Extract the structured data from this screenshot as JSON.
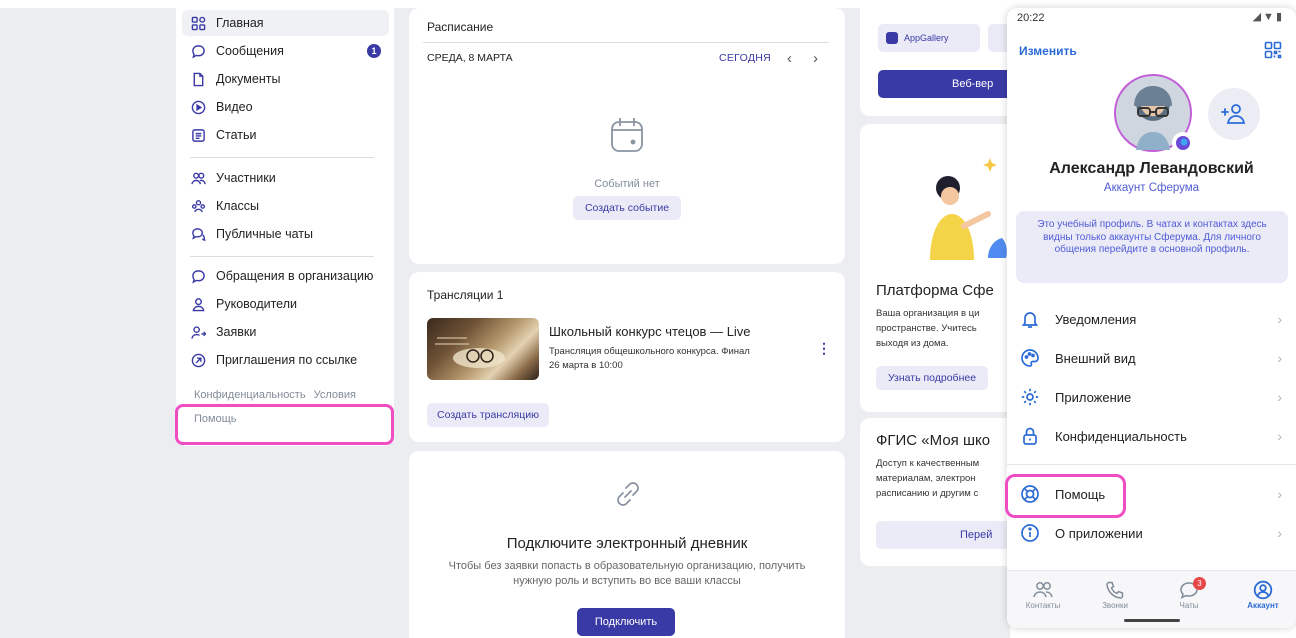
{
  "sidebar": {
    "items": [
      {
        "label": "Главная"
      },
      {
        "label": "Сообщения",
        "badge": "1"
      },
      {
        "label": "Документы"
      },
      {
        "label": "Видео"
      },
      {
        "label": "Статьи"
      },
      {
        "label": "Участники"
      },
      {
        "label": "Классы"
      },
      {
        "label": "Публичные чаты"
      },
      {
        "label": "Обращения в организацию"
      },
      {
        "label": "Руководители"
      },
      {
        "label": "Заявки"
      },
      {
        "label": "Приглашения по ссылке"
      }
    ],
    "footer": {
      "privacy": "Конфиденциальность",
      "terms": "Условия",
      "help": "Помощь"
    }
  },
  "schedule": {
    "title": "Расписание",
    "date": "СРЕДА, 8 МАРТА",
    "today": "СЕГОДНЯ",
    "prev": "‹",
    "next": "›",
    "empty": "Событий нет",
    "create_button": "Создать событие"
  },
  "streams": {
    "title": "Трансляции 1",
    "item": {
      "title": "Школьный конкурс чтецов — Live",
      "subtitle": "Трансляция общешкольного конкурса. Финал",
      "date": "26 марта в 10:00"
    },
    "menu": "⋮",
    "create_button": "Создать трансляцию"
  },
  "diary": {
    "title": "Подключите электронный дневник",
    "text_line1": "Чтобы без заявки попасть в образовательную организацию, получить",
    "text_line2": "нужную роль и вступить во все ваши классы",
    "button": "Подключить"
  },
  "right_column": {
    "appgallery": "AppGallery",
    "web_button": "Веб-вер",
    "platform_title": "Платформа Сфе",
    "platform_text_1": "Ваша организация в ци",
    "platform_text_2": "пространстве. Учитесь",
    "platform_text_3": "выходя из дома.",
    "learn_more": "Узнать подробнее",
    "fgis_title": "ФГИС «Моя шко",
    "fgis_text_1": "Доступ к качественным",
    "fgis_text_2": "материалам, электрон",
    "fgis_text_3": "расписанию и другим с",
    "go_button": "Перей"
  },
  "phone": {
    "time": "20:22",
    "status_icons": "◢▼▮",
    "edit": "Изменить",
    "name": "Александр Левандовский",
    "account_type": "Аккаунт Сферума",
    "info": "Это учебный профиль. В чатах и контактах здесь видны только аккаунты Сферума. Для личного общения перейдите в основной профиль.",
    "menu": [
      {
        "label": "Уведомления"
      },
      {
        "label": "Внешний вид"
      },
      {
        "label": "Приложение"
      },
      {
        "label": "Конфиденциальность"
      },
      {
        "label": "Помощь"
      },
      {
        "label": "О приложении"
      }
    ],
    "chevron": "›",
    "tabs": [
      {
        "label": "Контакты"
      },
      {
        "label": "Звонки"
      },
      {
        "label": "Чаты",
        "badge": "3"
      },
      {
        "label": "Аккаунт"
      }
    ]
  },
  "colors": {
    "accent": "#3a3aa6",
    "link": "#2b6bd6",
    "highlight": "#f04dc3",
    "background": "#ebedf0"
  }
}
